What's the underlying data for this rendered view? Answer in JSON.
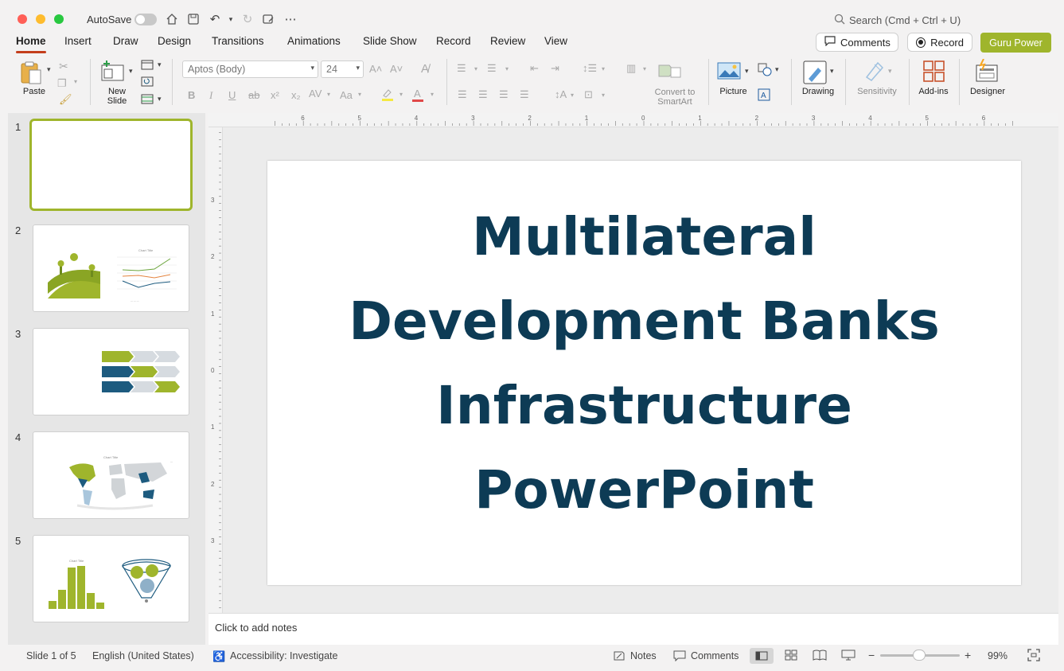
{
  "titlebar": {
    "autosave_label": "AutoSave",
    "search_placeholder": "Search (Cmd + Ctrl + U)"
  },
  "tabs": [
    "Home",
    "Insert",
    "Draw",
    "Design",
    "Transitions",
    "Animations",
    "Slide Show",
    "Record",
    "Review",
    "View"
  ],
  "header_buttons": {
    "comments": "Comments",
    "record": "Record",
    "guru": "Guru Power"
  },
  "ribbon": {
    "paste": "Paste",
    "new_slide_line1": "New",
    "new_slide_line2": "Slide",
    "font_name": "Aptos (Body)",
    "font_size": "24",
    "convert_line1": "Convert to",
    "convert_line2": "SmartArt",
    "picture": "Picture",
    "drawing": "Drawing",
    "sensitivity": "Sensitivity",
    "addins": "Add-ins",
    "designer": "Designer"
  },
  "slides": [
    "1",
    "2",
    "3",
    "4",
    "5"
  ],
  "slide": {
    "line1": "Multilateral",
    "line2": "Development Banks",
    "line3": "Infrastructure",
    "line4": "PowerPoint"
  },
  "notes_placeholder": "Click to add notes",
  "status": {
    "slide_of": "Slide 1 of 5",
    "language": "English (United States)",
    "accessibility": "Accessibility: Investigate",
    "notes": "Notes",
    "comments": "Comments",
    "zoom": "99%"
  },
  "ruler_h": [
    "6",
    "5",
    "4",
    "3",
    "2",
    "1",
    "0",
    "1",
    "2",
    "3",
    "4",
    "5",
    "6"
  ],
  "ruler_v": [
    "3",
    "2",
    "1",
    "0",
    "1",
    "2",
    "3"
  ],
  "colors": {
    "accent": "#c43e1c",
    "brand_green": "#9fb52c",
    "title": "#0d3b55",
    "teal": "#1d5b7f"
  }
}
